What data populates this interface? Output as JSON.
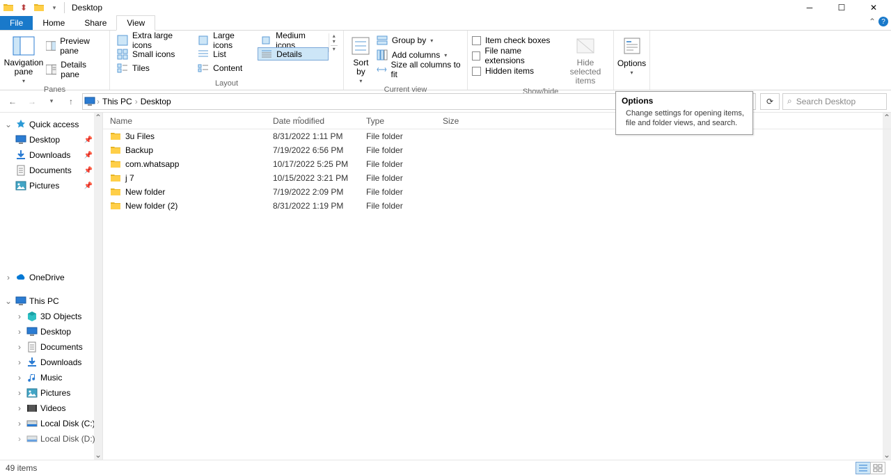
{
  "title": "Desktop",
  "tabs": {
    "file": "File",
    "home": "Home",
    "share": "Share",
    "view": "View"
  },
  "ribbon": {
    "panes": {
      "nav": "Navigation\npane",
      "preview": "Preview pane",
      "details": "Details pane",
      "label": "Panes"
    },
    "layout": {
      "extra_large": "Extra large icons",
      "large": "Large icons",
      "medium": "Medium icons",
      "small": "Small icons",
      "list": "List",
      "details": "Details",
      "tiles": "Tiles",
      "content": "Content",
      "label": "Layout"
    },
    "currentview": {
      "sort": "Sort\nby",
      "group": "Group by",
      "add_columns": "Add columns",
      "size_all": "Size all columns to fit",
      "label": "Current view"
    },
    "showhide": {
      "item_check": "Item check boxes",
      "ext": "File name extensions",
      "hidden": "Hidden items",
      "hide_selected": "Hide selected\nitems",
      "label": "Show/hide"
    },
    "options_group": {
      "options": "Options"
    }
  },
  "breadcrumb": {
    "pc": "This PC",
    "desktop": "Desktop"
  },
  "search": {
    "placeholder": "Search Desktop"
  },
  "columns": {
    "name": "Name",
    "date": "Date modified",
    "type": "Type",
    "size": "Size"
  },
  "tooltip": {
    "title": "Options",
    "text": "Change settings for opening items, file and folder views, and search."
  },
  "files": [
    {
      "name": "3u Files",
      "date": "8/31/2022 1:11 PM",
      "type": "File folder"
    },
    {
      "name": "Backup",
      "date": "7/19/2022 6:56 PM",
      "type": "File folder"
    },
    {
      "name": "com.whatsapp",
      "date": "10/17/2022 5:25 PM",
      "type": "File folder"
    },
    {
      "name": "j 7",
      "date": "10/15/2022 3:21 PM",
      "type": "File folder"
    },
    {
      "name": "New folder",
      "date": "7/19/2022 2:09 PM",
      "type": "File folder"
    },
    {
      "name": "New folder (2)",
      "date": "8/31/2022 1:19 PM",
      "type": "File folder"
    }
  ],
  "sidebar": {
    "quick_access": "Quick access",
    "desktop": "Desktop",
    "downloads": "Downloads",
    "documents": "Documents",
    "pictures": "Pictures",
    "onedrive": "OneDrive",
    "this_pc": "This PC",
    "objects3d": "3D Objects",
    "desktop2": "Desktop",
    "documents2": "Documents",
    "downloads2": "Downloads",
    "music": "Music",
    "pictures2": "Pictures",
    "videos": "Videos",
    "diskc": "Local Disk (C:)",
    "diskd": "Local Disk (D:)"
  },
  "status": {
    "items": "49 items"
  }
}
